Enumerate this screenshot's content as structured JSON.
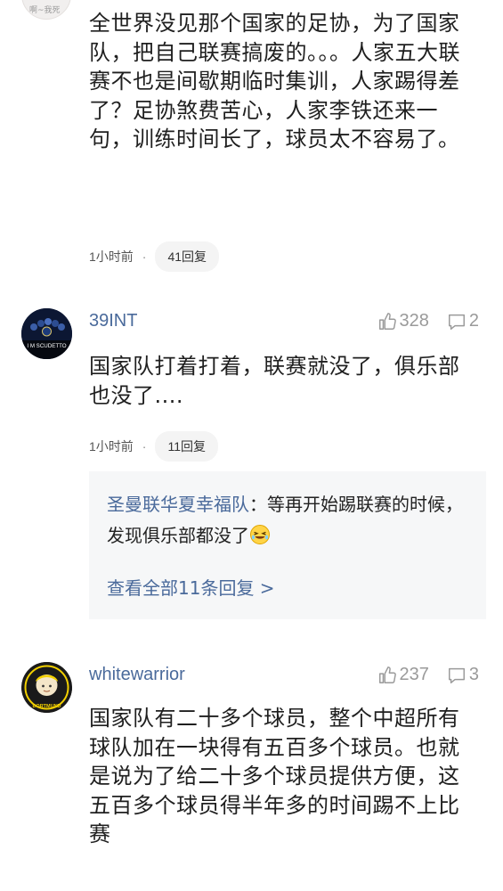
{
  "partial_top": {
    "avatar_label": "啊~我死",
    "text": "全世界没见那个国家的足协，为了国家队，把自己联赛搞废的。。。人家五大联赛不也是间歇期临时集训，人家踢得差了？足协煞费苦心，人家李铁还来一句，训练时间长了，球员太不容易了。",
    "time": "1小时前",
    "reply_count": "41回复"
  },
  "comments": [
    {
      "username": "39INT",
      "avatar_text": "I M SCUDETTO",
      "likes": "328",
      "replies": "2",
      "text": "国家队打着打着，联赛就没了，俱乐部也没了....",
      "time": "1小时前",
      "reply_count": "11回复",
      "sub_reply_name": "圣曼联华夏幸福队",
      "sub_reply_text": "：等再开始踢联赛的时候，发现俱乐部都没了",
      "view_all": "查看全部11条回复 >"
    },
    {
      "username": "whitewarrior",
      "avatar_text": "DORTMUND",
      "likes": "237",
      "replies": "3",
      "text": "国家队有二十多个球员，整个中超所有球队加在一块得有五百多个球员。也就是说为了给二十多个球员提供方便，这五百多个球员得半年多的时间踢不上比赛"
    }
  ],
  "meta_separator": "·",
  "icons": {
    "like": "thumbs-up-icon",
    "reply": "comment-bubble-icon",
    "emoji": "laughing-emoji-icon"
  },
  "colors": {
    "link_blue": "#4a6a9b",
    "stat_gray": "#9a9a9a",
    "subreply_bg": "#f6f7f8"
  }
}
